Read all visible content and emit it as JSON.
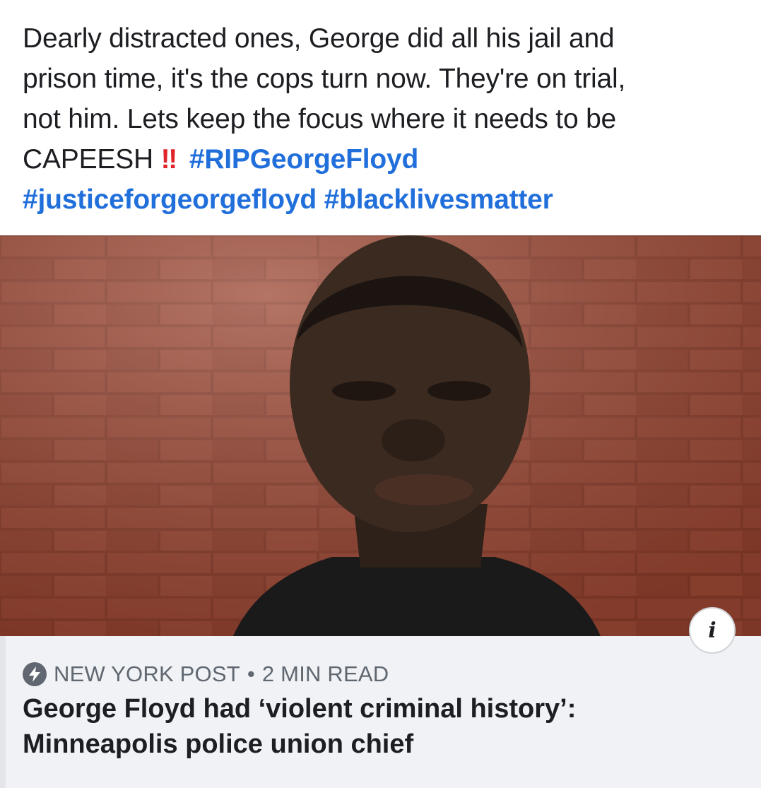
{
  "post": {
    "line1": "Dearly distracted ones, George did all his jail and",
    "line2": "prison time, it's the cops turn now. They're on trial,",
    "line3": "not him. Lets keep the focus where it needs to be",
    "line4_text": "CAPEESH",
    "emoji": "‼",
    "hashtags": [
      "#RIPGeorgeFloyd",
      "#justiceforgeorgefloyd",
      "#blacklivesmatter"
    ]
  },
  "photo": {
    "icon": "photo-of-man-against-brick-wall"
  },
  "info_icon": {
    "glyph": "i"
  },
  "link_card": {
    "source_icon": "lightning-bolt-icon",
    "source": "NEW YORK POST",
    "separator": "•",
    "read_time": "2 MIN READ",
    "headline_line1": "George Floyd had ‘violent criminal history’:",
    "headline_line2": "Minneapolis police union chief"
  },
  "colors": {
    "hashtag": "#216fdb",
    "emoji": "#e0242b",
    "text": "#1c1e21",
    "card_bg": "#f0f2f5",
    "meta": "#606770"
  }
}
